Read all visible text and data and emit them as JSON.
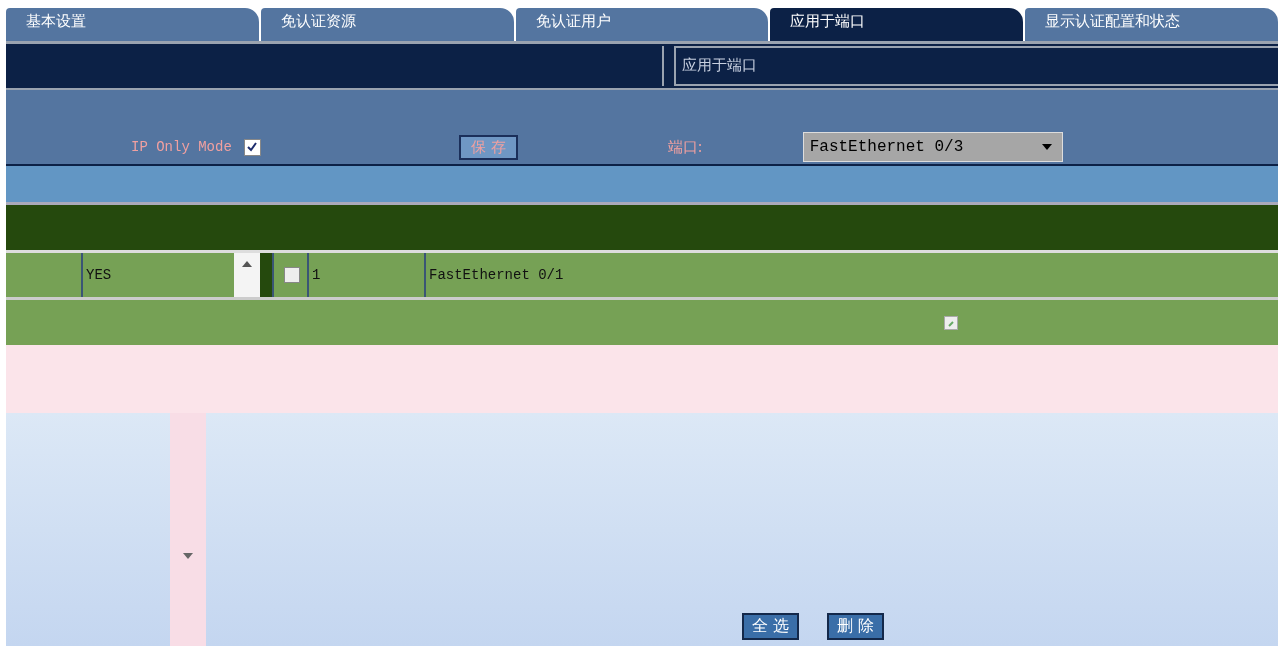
{
  "tabs": [
    {
      "label": "基本设置",
      "selected": false
    },
    {
      "label": "免认证资源",
      "selected": false
    },
    {
      "label": "免认证用户",
      "selected": false
    },
    {
      "label": "应用于端口",
      "selected": true
    },
    {
      "label": "显示认证配置和状态",
      "selected": false
    }
  ],
  "section_title": "应用于端口",
  "ip_only_mode": {
    "label": "IP Only Mode",
    "checked": true
  },
  "save_button": "保 存",
  "port": {
    "label": "端口:",
    "value": "FastEthernet 0/3"
  },
  "table": {
    "rows": [
      {
        "column_1": "YES",
        "checked": false,
        "index": "1",
        "port": "FastEthernet 0/1"
      }
    ]
  },
  "buttons": [
    "全 选",
    "删 除"
  ]
}
